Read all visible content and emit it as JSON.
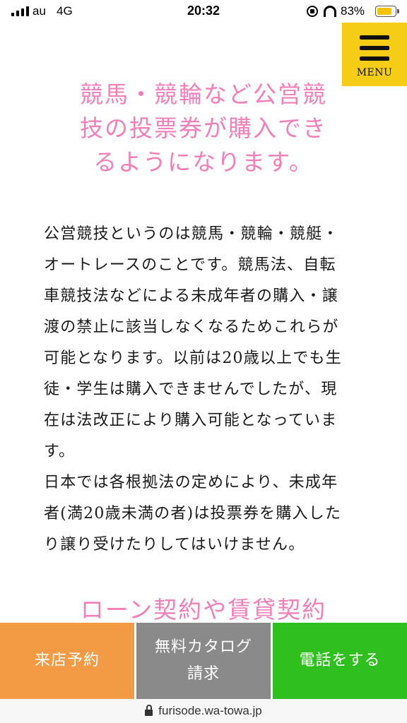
{
  "status_bar": {
    "carrier": "au",
    "network": "4G",
    "time": "20:32",
    "battery_percent": "83%",
    "battery_level": 0.83,
    "icons": [
      "signal-icon",
      "rotation-lock-icon",
      "headphones-icon",
      "battery-icon"
    ]
  },
  "menu": {
    "label": "MENU",
    "color": "#f6cd16"
  },
  "section1": {
    "heading_lines": [
      "競馬・競輪など公営競",
      "技の投票券が購入でき",
      "るようになります。"
    ],
    "paragraph_lines": [
      "公営競技というのは競馬・競輪・競艇・",
      "オートレースのことです。競馬法、自転",
      "車競技法などによる未成年者の購入・譲",
      "渡の禁止に該当しなくなるためこれらが",
      "可能となります。以前は20歳以上でも生",
      "徒・学生は購入できませんでしたが、現",
      "在は法改正により購入可能となっていま",
      "す。",
      "日本では各根拠法の定めにより、未成年",
      "者(満20歳未満の者)は投票券を購入した",
      "り譲り受けたりしてはいけません。"
    ]
  },
  "section2": {
    "heading_partial": "ローン契約や賃貸契約"
  },
  "heading_color": "#f27fb8",
  "cta": {
    "reserve_label": "来店予約",
    "catalog_label_lines": [
      "無料カタログ",
      "請求"
    ],
    "phone_label": "電話をする",
    "colors": {
      "reserve": "#f29a44",
      "catalog": "#8a8a8a",
      "phone": "#2fbf1e"
    }
  },
  "url_bar": {
    "url": "furisode.wa-towa.jp"
  }
}
